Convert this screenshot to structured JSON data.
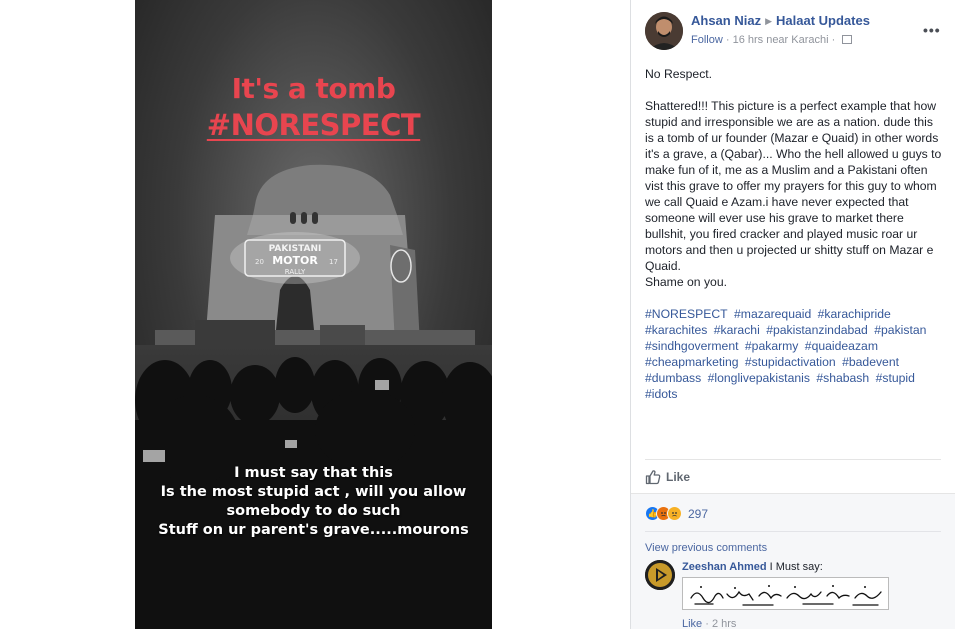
{
  "photo": {
    "title": "It's a tomb",
    "hashtag": "#NORESPECT",
    "caption_lines": [
      "I must say that this",
      "Is the most stupid act , will you allow",
      "somebody to do such",
      "Stuff on ur parent's grave.....mourons"
    ],
    "projection_lines": [
      "PAKISTANI",
      "MOTOR",
      "RALLY",
      "20",
      "17"
    ]
  },
  "post": {
    "author": "Ahsan Niaz",
    "group": "Halaat Updates",
    "follow_label": "Follow",
    "meta": " · 16 hrs near Karachi · ",
    "more_label": "•••",
    "paragraphs": [
      "No Respect.",
      "Shattered!!! This picture is a perfect example that how stupid and irresponsible we are as a nation. dude this is a tomb of ur founder (Mazar e Quaid) in other words it's a grave, a (Qabar)... Who the hell allowed u guys to make fun of it, me as a Muslim and a Pakistani often vist this grave to offer my prayers for this guy to whom we call Quaid e Azam.i have never expected that someone will ever use his grave to market there bullshit, you fired cracker and played music roar ur motors and then u projected ur shitty stuff on Mazar e Quaid.",
      "Shame on you."
    ],
    "hashtags": [
      "#NORESPECT",
      "#mazarequaid",
      "#karachipride",
      "#karachites",
      "#karachi",
      "#pakistanzindabad",
      "#pakistan",
      "#sindhgoverment",
      "#pakarmy",
      "#quaideazam",
      "#cheapmarketing",
      "#stupidactivation",
      "#badevent",
      "#dumbass",
      "#longlivepakistanis",
      "#shabash",
      "#stupid",
      "#idots"
    ],
    "like_label": "Like",
    "reaction_count": "297",
    "reaction_icons": [
      "like-icon",
      "angry-icon",
      "sad-icon"
    ],
    "colors": {
      "link": "#365899",
      "reaction_like": "#1877f2",
      "reaction_angry": "#e9710f",
      "reaction_sad": "#f7b125"
    }
  },
  "comments": {
    "view_previous": "View previous comments",
    "items": [
      {
        "author": "Zeeshan Ahmed",
        "text": " I Must say:",
        "like_label": "Like",
        "time": " · 2 hrs"
      }
    ]
  }
}
